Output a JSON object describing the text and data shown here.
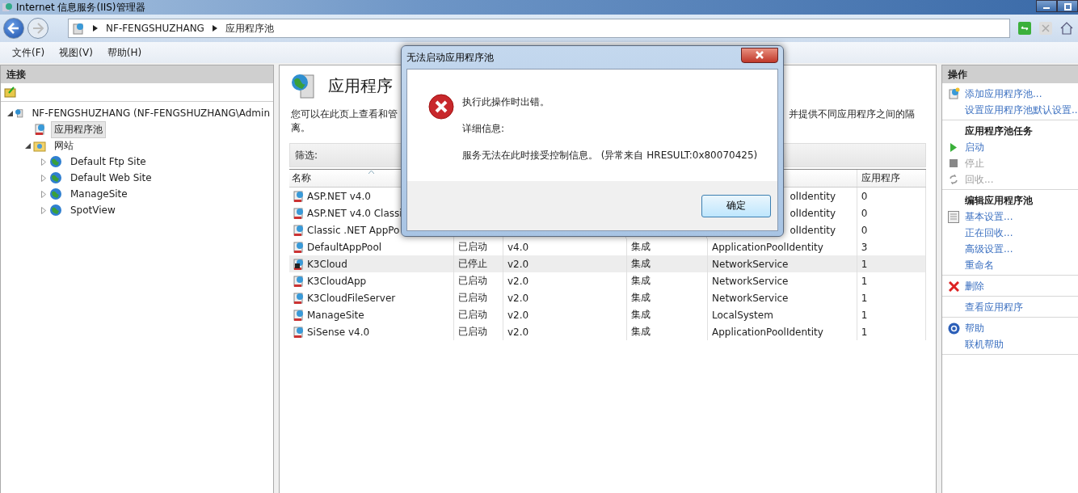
{
  "window": {
    "title": "Internet 信息服务(IIS)管理器"
  },
  "breadcrumb": [
    "NF-FENGSHUZHANG",
    "应用程序池"
  ],
  "menu": [
    "文件(F)",
    "视图(V)",
    "帮助(H)"
  ],
  "connections": {
    "title": "连接",
    "tree": [
      {
        "label": "NF-FENGSHUZHANG (NF-FENGSHUZHANG\\Admin",
        "expanded": true,
        "selected": false,
        "children": [
          {
            "label": "应用程序池",
            "selected": true
          },
          {
            "label": "网站",
            "expanded": true,
            "selected": false,
            "children": [
              {
                "label": "Default Ftp Site",
                "expanded": false,
                "selected": false
              },
              {
                "label": "Default Web Site",
                "expanded": false,
                "selected": false
              },
              {
                "label": "ManageSite",
                "expanded": false,
                "selected": false
              },
              {
                "label": "SpotView",
                "expanded": false,
                "selected": false
              }
            ]
          }
        ]
      }
    ]
  },
  "content": {
    "title": "应用程序",
    "description": {
      "line1_left": "您可以在此页上查看和管",
      "line1_right": "并提供不同应用程序之间的隔",
      "line2": "离。"
    },
    "filter_label": "筛选:",
    "columns": {
      "name": "名称",
      "apps": "应用程序"
    },
    "rows": [
      {
        "name": "ASP.NET v4.0",
        "identity": "olIdentity",
        "apps": "0",
        "stopped": false,
        "selected": false
      },
      {
        "name": "ASP.NET v4.0 Classi",
        "identity": "olIdentity",
        "apps": "0",
        "stopped": false,
        "selected": false
      },
      {
        "name": "Classic .NET AppPo",
        "identity": "olIdentity",
        "apps": "0",
        "stopped": false,
        "selected": false
      },
      {
        "name": "DefaultAppPool",
        "status": "已启动",
        "version": "v4.0",
        "pipeline": "集成",
        "identity": "ApplicationPoolIdentity",
        "apps": "3",
        "stopped": false,
        "selected": false
      },
      {
        "name": "K3Cloud",
        "status": "已停止",
        "version": "v2.0",
        "pipeline": "集成",
        "identity": "NetworkService",
        "apps": "1",
        "stopped": true,
        "selected": true
      },
      {
        "name": "K3CloudApp",
        "status": "已启动",
        "version": "v2.0",
        "pipeline": "集成",
        "identity": "NetworkService",
        "apps": "1",
        "stopped": false,
        "selected": false
      },
      {
        "name": "K3CloudFileServer",
        "status": "已启动",
        "version": "v2.0",
        "pipeline": "集成",
        "identity": "NetworkService",
        "apps": "1",
        "stopped": false,
        "selected": false
      },
      {
        "name": "ManageSite",
        "status": "已启动",
        "version": "v2.0",
        "pipeline": "集成",
        "identity": "LocalSystem",
        "apps": "1",
        "stopped": false,
        "selected": false
      },
      {
        "name": "SiSense v4.0",
        "status": "已启动",
        "version": "v2.0",
        "pipeline": "集成",
        "identity": "ApplicationPoolIdentity",
        "apps": "1",
        "stopped": false,
        "selected": false
      }
    ]
  },
  "actions": {
    "title": "操作",
    "groups": [
      {
        "items": [
          {
            "label": "添加应用程序池...",
            "kind": "link"
          },
          {
            "label": "设置应用程序池默认设置..",
            "kind": "link"
          }
        ]
      },
      {
        "items": [
          {
            "label": "应用程序池任务",
            "kind": "heading"
          },
          {
            "label": "启动",
            "kind": "link"
          },
          {
            "label": "停止",
            "kind": "disabled"
          },
          {
            "label": "回收...",
            "kind": "disabled"
          }
        ]
      },
      {
        "items": [
          {
            "label": "编辑应用程序池",
            "kind": "heading"
          },
          {
            "label": "基本设置...",
            "kind": "link"
          },
          {
            "label": "正在回收...",
            "kind": "link"
          },
          {
            "label": "高级设置...",
            "kind": "link"
          },
          {
            "label": "重命名",
            "kind": "link"
          }
        ]
      },
      {
        "items": [
          {
            "label": "删除",
            "kind": "link"
          }
        ]
      },
      {
        "items": [
          {
            "label": "查看应用程序",
            "kind": "link"
          }
        ]
      },
      {
        "items": [
          {
            "label": "帮助",
            "kind": "link"
          },
          {
            "label": "联机帮助",
            "kind": "link"
          }
        ]
      }
    ]
  },
  "dialog": {
    "title": "无法启动应用程序池",
    "message": "执行此操作时出错。",
    "details_label": "详细信息:",
    "details": "服务无法在此时接受控制信息。 (异常来自 HRESULT:0x80070425)",
    "button": "确定"
  }
}
